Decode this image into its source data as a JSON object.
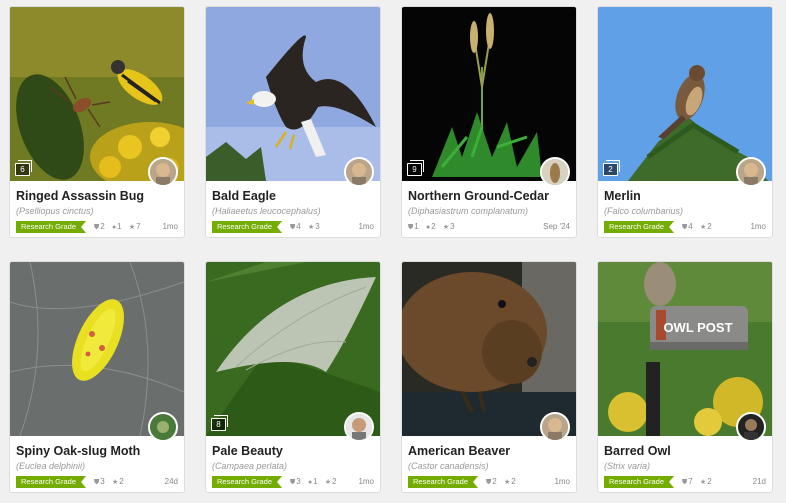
{
  "cards": [
    {
      "title": "Ringed Assassin Bug",
      "sci": "(Pselliopus cinctus)",
      "grade": "Research Grade",
      "photo_count": "6",
      "ids": "2",
      "comments": "1",
      "faves": "7",
      "age": "1mo"
    },
    {
      "title": "Bald Eagle",
      "sci": "(Haliaeetus leucocephalus)",
      "grade": "Research Grade",
      "photo_count": "",
      "ids": "4",
      "comments": "",
      "faves": "3",
      "age": "1mo"
    },
    {
      "title": "Northern Ground-Cedar",
      "sci": "(Diphasiastrum complanatum)",
      "grade": "",
      "photo_count": "9",
      "ids": "1",
      "comments": "2",
      "faves": "3",
      "age": "Sep '24"
    },
    {
      "title": "Merlin",
      "sci": "(Falco columbarius)",
      "grade": "Research Grade",
      "photo_count": "2",
      "ids": "4",
      "comments": "",
      "faves": "2",
      "age": "1mo"
    },
    {
      "title": "Spiny Oak-slug Moth",
      "sci": "(Euclea delphinii)",
      "grade": "Research Grade",
      "photo_count": "",
      "ids": "3",
      "comments": "",
      "faves": "2",
      "age": "24d"
    },
    {
      "title": "Pale Beauty",
      "sci": "(Campaea perlata)",
      "grade": "Research Grade",
      "photo_count": "8",
      "ids": "3",
      "comments": "1",
      "faves": "2",
      "age": "1mo"
    },
    {
      "title": "American Beaver",
      "sci": "(Castor canadensis)",
      "grade": "Research Grade",
      "photo_count": "",
      "ids": "2",
      "comments": "",
      "faves": "2",
      "age": "1mo"
    },
    {
      "title": "Barred Owl",
      "sci": "(Strix varia)",
      "grade": "Research Grade",
      "photo_count": "",
      "ids": "7",
      "comments": "",
      "faves": "2",
      "age": "21d"
    }
  ],
  "mailbox_text": "OWL POST",
  "icons": {
    "ids": "id-shield-icon",
    "comments": "comment-icon",
    "faves": "star-icon"
  },
  "colors": {
    "research_grade": "#74ac00"
  }
}
